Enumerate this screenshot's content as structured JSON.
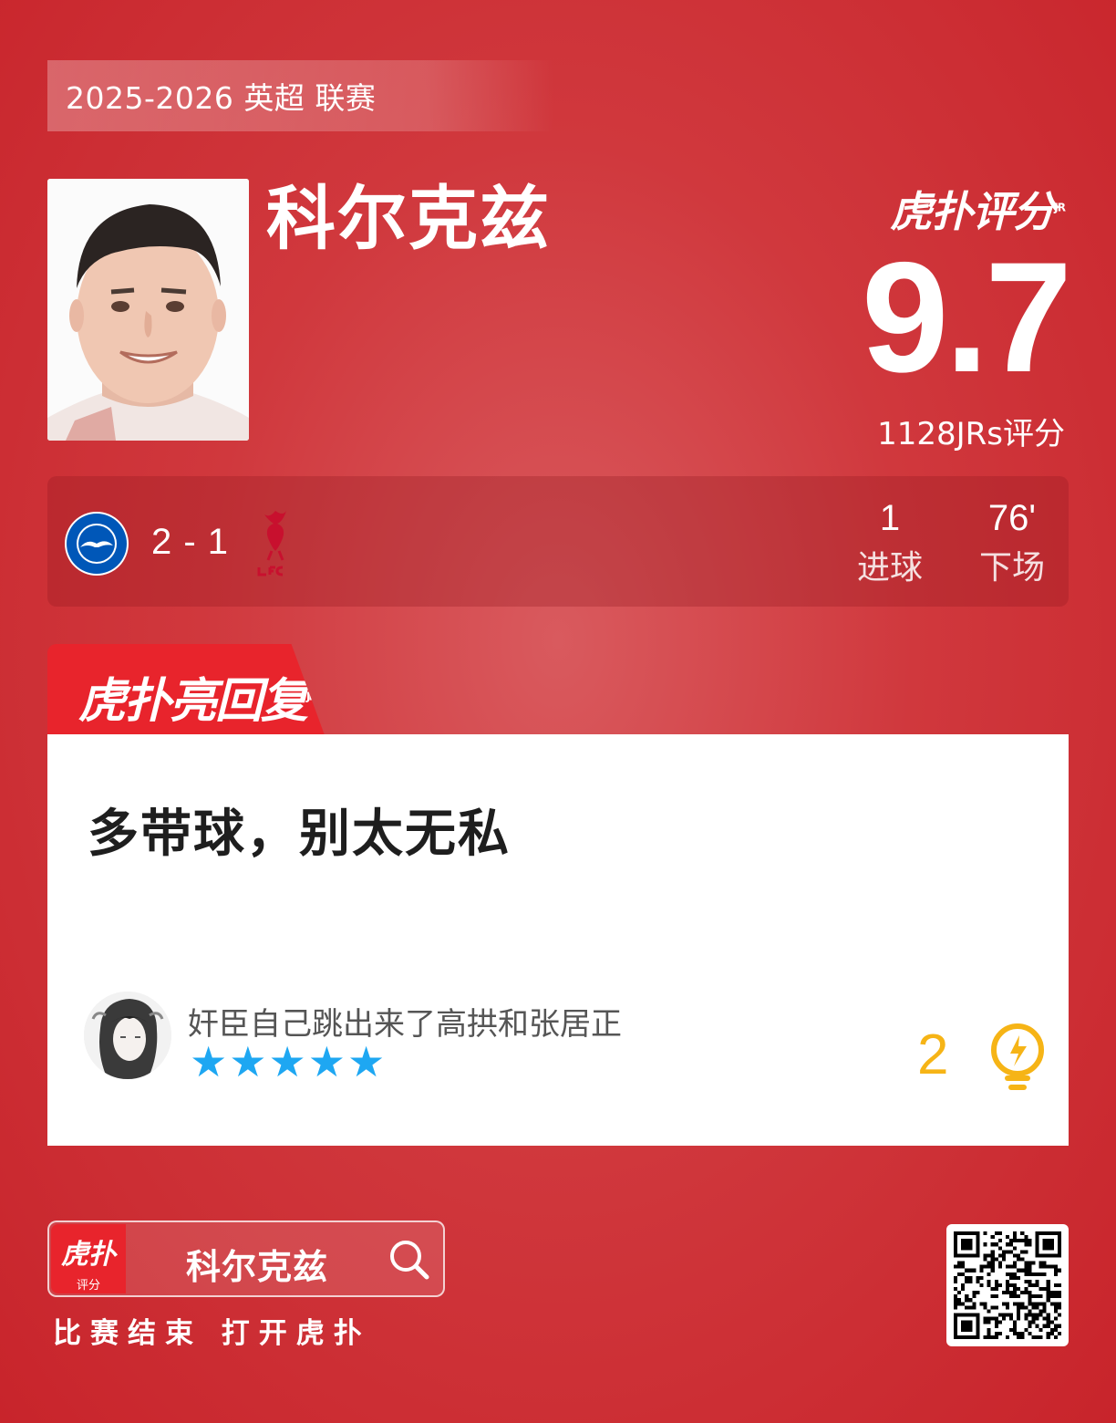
{
  "league": {
    "title": "2025-2026 英超 联赛"
  },
  "player": {
    "name": "科尔克兹"
  },
  "brand": {
    "logo_text": "虎扑评分",
    "logo_sup": "JR"
  },
  "rating": {
    "score": "9.7",
    "count_text": "1128JRs评分"
  },
  "match": {
    "home_team_icon": "brighton-crest-icon",
    "score": "2 - 1",
    "away_team_icon": "liverpool-crest-icon",
    "stats": [
      {
        "value": "1",
        "label": "进球"
      },
      {
        "value": "76'",
        "label": "下场"
      }
    ]
  },
  "reply": {
    "tab_label": "虎扑亮回复",
    "tab_sup": "JR",
    "text": "多带球，别太无私",
    "username": "奸臣自己跳出来了高拱和张居正",
    "stars": "★★★★★",
    "star_count": 5,
    "likes": "2",
    "like_icon": "lightbulb-icon"
  },
  "footer": {
    "app_icon_title": "虎扑",
    "app_icon_sub": "评分",
    "search_text": "科尔克兹",
    "caption": "比赛结束 打开虎扑"
  },
  "colors": {
    "background": "#d0383d",
    "accent_red": "#e8242c",
    "star_blue": "#1ea7f2",
    "like_gold": "#f6b416"
  }
}
